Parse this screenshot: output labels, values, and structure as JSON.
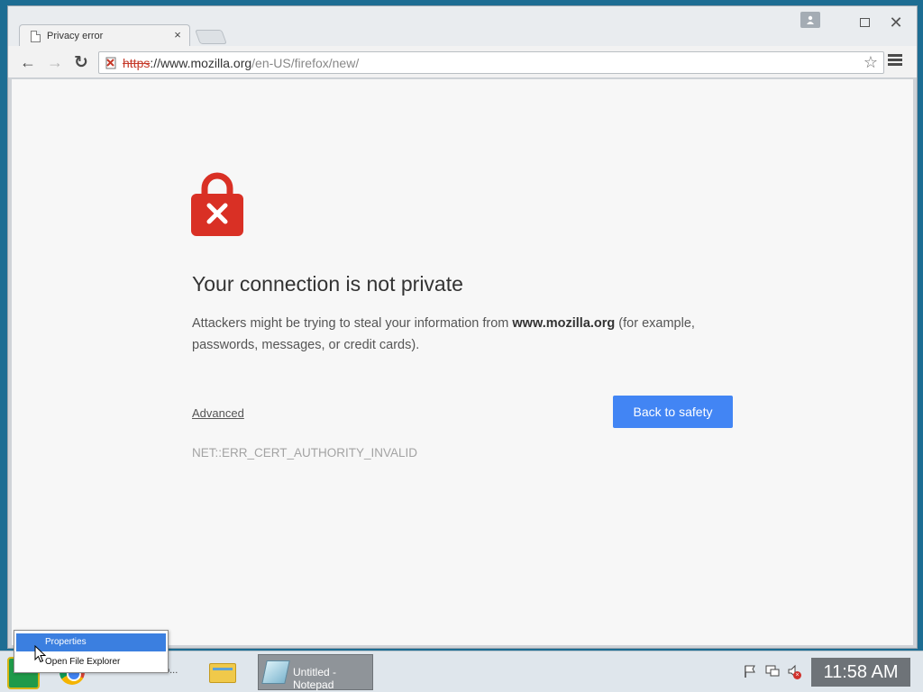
{
  "browser": {
    "tab_title": "Privacy error",
    "tab_close": "×",
    "url": {
      "scheme": "https",
      "host_prefix": "://www.mozilla.org",
      "path": "/en-US/firefox/new/"
    },
    "icons": {
      "back": "←",
      "forward": "→",
      "reload": "↻",
      "star": "☆",
      "close": "✕"
    }
  },
  "page": {
    "heading": "Your connection is not private",
    "desc_before": "Attackers might be trying to steal your information from ",
    "desc_host": "www.mozilla.org",
    "desc_after": " (for example, passwords, messages, or credit cards).",
    "advanced_label": "Advanced",
    "back_label": "Back to safety",
    "error_code": "NET::ERR_CERT_AUTHORITY_INVALID",
    "colors": {
      "lock": "#d93025",
      "button": "#4285f4"
    }
  },
  "taskbar": {
    "chrome_label": "o...",
    "notepad_label": "Untitled - Notepad",
    "clock": "11:58 AM"
  },
  "context_menu": {
    "items": [
      "Properties",
      "Open File Explorer"
    ]
  }
}
